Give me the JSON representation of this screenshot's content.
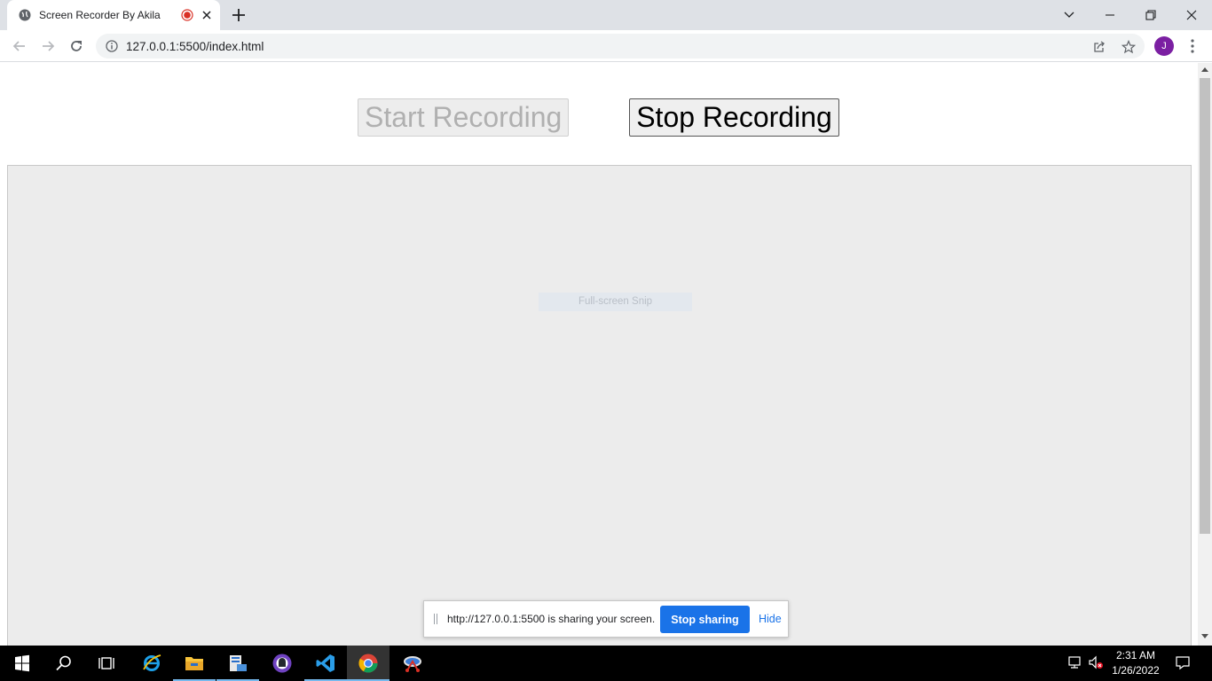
{
  "browser": {
    "tab": {
      "title": "Screen Recorder By Akila",
      "favicon": "globe-icon",
      "recording_indicator": "recording-dot-icon"
    },
    "window_controls": [
      "chevron-down-icon",
      "minimize-icon",
      "restore-icon",
      "close-icon"
    ],
    "address_bar": {
      "url": "127.0.0.1:5500/index.html"
    },
    "profile_initial": "J"
  },
  "page": {
    "start_button_label": "Start Recording",
    "stop_button_label": "Stop Recording",
    "video_overlay_text": "Full-screen Snip"
  },
  "share_bar": {
    "message": "http://127.0.0.1:5500 is sharing your screen.",
    "stop_label": "Stop sharing",
    "hide_label": "Hide"
  },
  "taskbar": {
    "apps": [
      "windows-start-icon",
      "search-icon",
      "task-view-icon",
      "internet-explorer-icon",
      "file-explorer-icon",
      "server-manager-icon",
      "github-desktop-icon",
      "vscode-icon",
      "chrome-icon",
      "snipping-tool-icon"
    ],
    "time": "2:31 AM",
    "date": "1/26/2022"
  },
  "colors": {
    "accent": "#1a73e8",
    "avatar": "#7b1fa2",
    "recording": "#d93025"
  }
}
